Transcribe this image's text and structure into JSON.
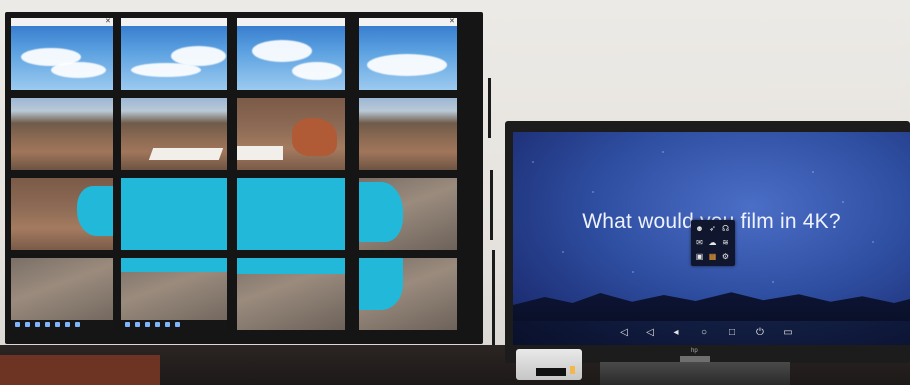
{
  "scene": {
    "monitor": {
      "headline": "What would you film in 4K?",
      "brand": "hp"
    },
    "colors": {
      "screen_blue": "#2f4fa2",
      "lake_turquoise": "#22b8da",
      "sky_blue": "#5aa0e0"
    }
  }
}
